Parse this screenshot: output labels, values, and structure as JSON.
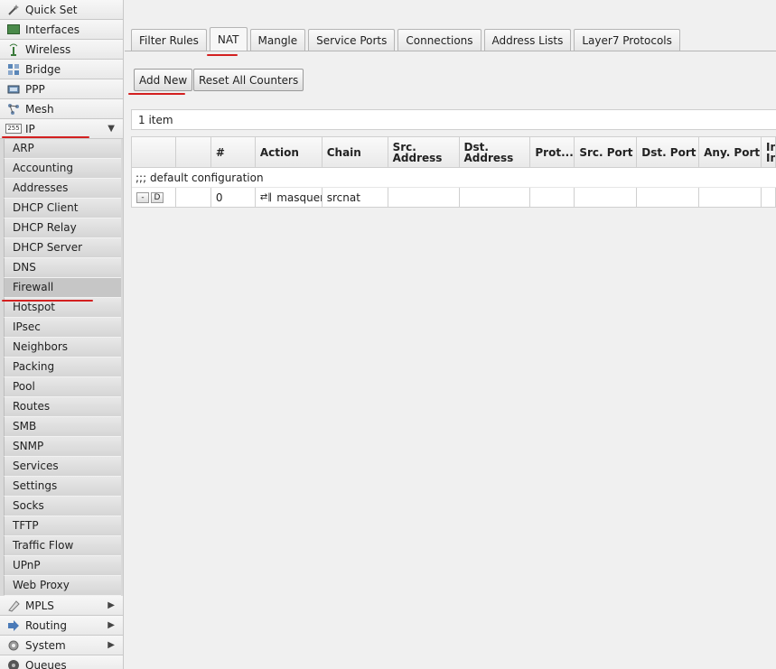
{
  "sidebar": {
    "top_items": [
      {
        "label": "Quick Set",
        "icon": "wand-icon"
      },
      {
        "label": "Interfaces",
        "icon": "interfaces-icon"
      },
      {
        "label": "Wireless",
        "icon": "wireless-icon"
      },
      {
        "label": "Bridge",
        "icon": "bridge-icon"
      },
      {
        "label": "PPP",
        "icon": "ppp-icon"
      },
      {
        "label": "Mesh",
        "icon": "mesh-icon"
      },
      {
        "label": "IP",
        "icon": "ip-icon",
        "expanded_arrow": "▼"
      }
    ],
    "ip_submenu": [
      "ARP",
      "Accounting",
      "Addresses",
      "DHCP Client",
      "DHCP Relay",
      "DHCP Server",
      "DNS",
      "Firewall",
      "Hotspot",
      "IPsec",
      "Neighbors",
      "Packing",
      "Pool",
      "Routes",
      "SMB",
      "SNMP",
      "Services",
      "Settings",
      "Socks",
      "TFTP",
      "Traffic Flow",
      "UPnP",
      "Web Proxy"
    ],
    "active_submenu": "Firewall",
    "bottom_items": [
      {
        "label": "MPLS",
        "icon": "mpls-icon",
        "arrow": "▶"
      },
      {
        "label": "Routing",
        "icon": "routing-icon",
        "arrow": "▶"
      },
      {
        "label": "System",
        "icon": "gear-icon",
        "arrow": "▶"
      },
      {
        "label": "Queues",
        "icon": "queues-icon"
      }
    ]
  },
  "tabs": [
    "Filter Rules",
    "NAT",
    "Mangle",
    "Service Ports",
    "Connections",
    "Address Lists",
    "Layer7 Protocols"
  ],
  "active_tab": "NAT",
  "toolbar": {
    "add_new": "Add New",
    "reset_counters": "Reset All Counters"
  },
  "item_count": "1 item",
  "table": {
    "headers": [
      "",
      "",
      "#",
      "Action",
      "Chain",
      "Src.\nAddress",
      "Dst.\nAddress",
      "Prot...",
      "Src. Port",
      "Dst. Port",
      "Any. Port",
      "In.\nIn"
    ],
    "comment": ";;; default configuration",
    "rows": [
      {
        "btn_minus": "-",
        "btn_d": "D",
        "num": "0",
        "action_icon": "⇄‖",
        "action": "masquer",
        "chain": "srcnat"
      }
    ]
  },
  "colors": {
    "annotation_underline": "#d32020"
  }
}
